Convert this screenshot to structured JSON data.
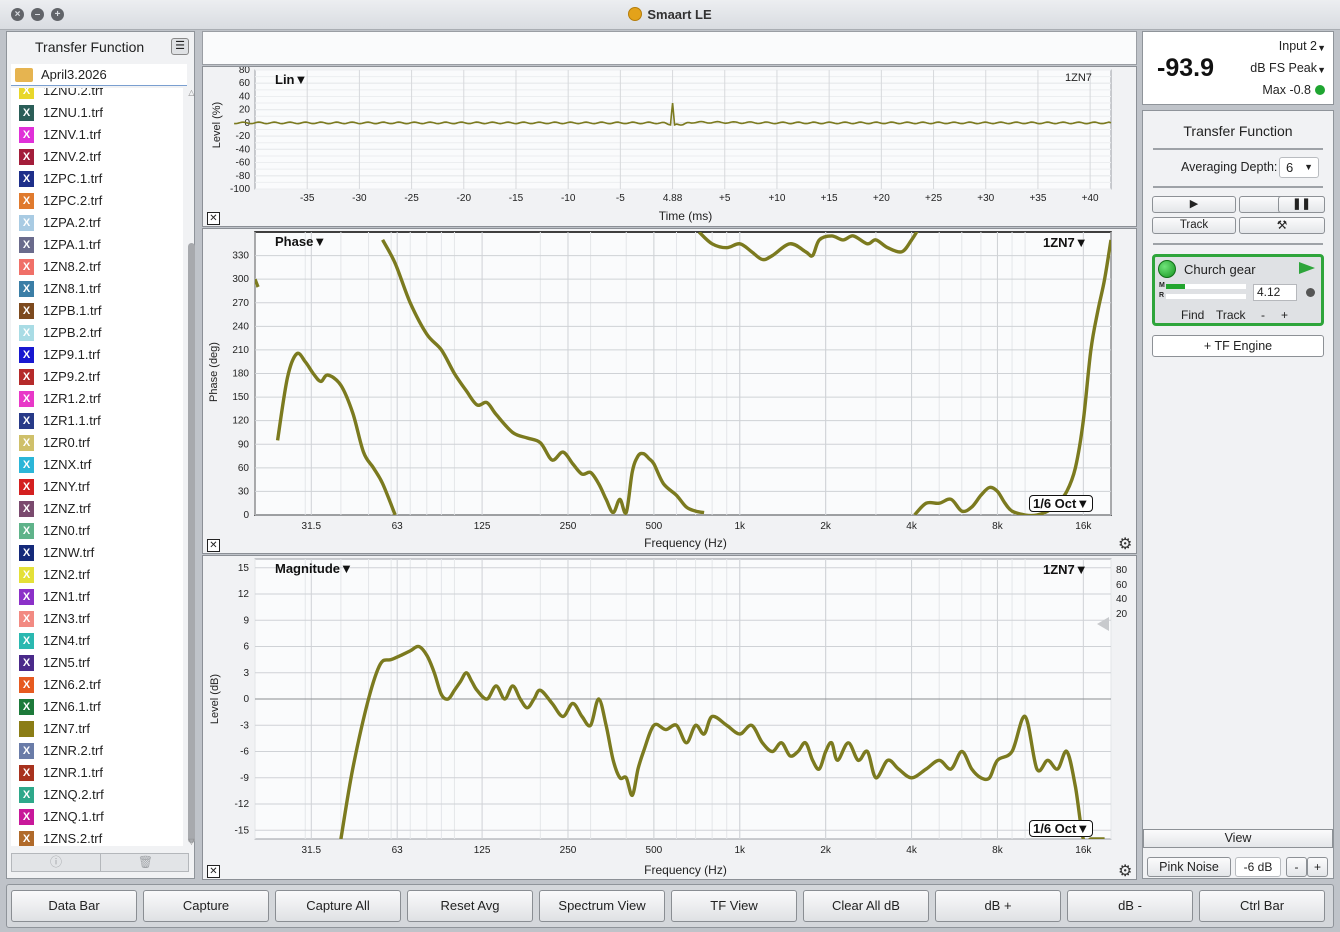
{
  "window": {
    "title": "Smaart LE"
  },
  "left_panel": {
    "title": "Transfer Function",
    "folder": "April3.2026",
    "files": [
      {
        "name": "1ZNU.2.trf",
        "color": "#e8d72a"
      },
      {
        "name": "1ZNU.1.trf",
        "color": "#2b5e58"
      },
      {
        "name": "1ZNV.1.trf",
        "color": "#e030d8"
      },
      {
        "name": "1ZNV.2.trf",
        "color": "#a31d3a"
      },
      {
        "name": "1ZPC.1.trf",
        "color": "#1e2f8a"
      },
      {
        "name": "1ZPC.2.trf",
        "color": "#e07a2e"
      },
      {
        "name": "1ZPA.2.trf",
        "color": "#a9cbe3"
      },
      {
        "name": "1ZPA.1.trf",
        "color": "#6a6b8c"
      },
      {
        "name": "1ZN8.2.trf",
        "color": "#f07068"
      },
      {
        "name": "1ZN8.1.trf",
        "color": "#3b7ea6"
      },
      {
        "name": "1ZPB.1.trf",
        "color": "#7d4a1e"
      },
      {
        "name": "1ZPB.2.trf",
        "color": "#a9dce5"
      },
      {
        "name": "1ZP9.1.trf",
        "color": "#1818d0"
      },
      {
        "name": "1ZP9.2.trf",
        "color": "#b52a2a"
      },
      {
        "name": "1ZR1.2.trf",
        "color": "#e838c8"
      },
      {
        "name": "1ZR1.1.trf",
        "color": "#283a88"
      },
      {
        "name": "1ZR0.trf",
        "color": "#cfc06a"
      },
      {
        "name": "1ZNX.trf",
        "color": "#2bb6d8"
      },
      {
        "name": "1ZNY.trf",
        "color": "#d42020"
      },
      {
        "name": "1ZNZ.trf",
        "color": "#7a4a6e"
      },
      {
        "name": "1ZN0.trf",
        "color": "#5fb38a"
      },
      {
        "name": "1ZNW.trf",
        "color": "#152a7a"
      },
      {
        "name": "1ZN2.trf",
        "color": "#e4e038"
      },
      {
        "name": "1ZN1.trf",
        "color": "#8b30c8"
      },
      {
        "name": "1ZN3.trf",
        "color": "#f28a82"
      },
      {
        "name": "1ZN4.trf",
        "color": "#2ab8b0"
      },
      {
        "name": "1ZN5.trf",
        "color": "#4a2a8a"
      },
      {
        "name": "1ZN6.2.trf",
        "color": "#e65a20"
      },
      {
        "name": "1ZN6.1.trf",
        "color": "#1d7a3a"
      },
      {
        "name": "1ZN7.trf",
        "color": "#8b7d16"
      },
      {
        "name": "1ZNR.2.trf",
        "color": "#6a7ca8"
      },
      {
        "name": "1ZNR.1.trf",
        "color": "#a8321e"
      },
      {
        "name": "1ZNQ.2.trf",
        "color": "#2ea88a"
      },
      {
        "name": "1ZNQ.1.trf",
        "color": "#c8189a"
      },
      {
        "name": "1ZNS.2.trf",
        "color": "#b06a2a"
      }
    ],
    "footer": {
      "info_icon": "info-icon",
      "trash_icon": "trash-icon"
    }
  },
  "plots": {
    "ir": {
      "label": "Lin",
      "trace": "1ZN7",
      "xlabel": "Time (ms)",
      "ylabel": "Level (%)"
    },
    "phase": {
      "label": "Phase",
      "trace": "1ZN7",
      "xlabel": "Frequency (Hz)",
      "ylabel": "Phase (deg)",
      "smoothing": "1/6 Oct"
    },
    "magnitude": {
      "label": "Magnitude",
      "trace": "1ZN7",
      "xlabel": "Frequency (Hz)",
      "ylabel": "Level (dB)",
      "smoothing": "1/6 Oct",
      "coherence_ticks": [
        "80",
        "60",
        "40",
        "20"
      ]
    }
  },
  "chart_data": [
    {
      "type": "line",
      "name": "impulse",
      "ylim": [
        -100,
        80
      ],
      "xlim": [
        -40,
        42
      ],
      "yticks": [
        "80",
        "60",
        "40",
        "20",
        "0",
        "-20",
        "-40",
        "-60",
        "-80",
        "-100"
      ],
      "xticks": [
        "-35",
        "-30",
        "-25",
        "-20",
        "-15",
        "-10",
        "-5",
        "4.88",
        "+5",
        "+10",
        "+15",
        "+20",
        "+25",
        "+30",
        "+35",
        "+40"
      ],
      "series": [
        {
          "x": [
            -42,
            -10,
            -1,
            -0.2,
            0,
            0.2,
            1,
            2,
            10,
            42
          ],
          "values": [
            0,
            0,
            0,
            -2,
            30,
            -3,
            -2,
            1,
            0,
            0
          ]
        }
      ],
      "color": "#7b7a1f"
    },
    {
      "type": "line",
      "name": "phase",
      "ylim": [
        0,
        360
      ],
      "xlim": [
        20,
        20000
      ],
      "xscale": "log",
      "yticks": [
        "330",
        "300",
        "270",
        "240",
        "210",
        "180",
        "150",
        "120",
        "90",
        "60",
        "30",
        "0"
      ],
      "xticks": [
        "31.5",
        "63",
        "125",
        "250",
        "500",
        "1k",
        "2k",
        "4k",
        "8k",
        "16k"
      ],
      "segments": [
        {
          "x": [
            20,
            20.5
          ],
          "values": [
            300,
            290
          ]
        },
        {
          "x": [
            24,
            26,
            28,
            30,
            32,
            34,
            36,
            40,
            44,
            48,
            52,
            56,
            62
          ],
          "values": [
            95,
            175,
            205,
            195,
            180,
            170,
            178,
            165,
            130,
            80,
            60,
            40,
            0
          ]
        },
        {
          "x": [
            56,
            62,
            70,
            80,
            90,
            100,
            110,
            120,
            130,
            140,
            160,
            180,
            200,
            220,
            240,
            260,
            280,
            300,
            320,
            340,
            360,
            380,
            400,
            420,
            440,
            460,
            480,
            500,
            540,
            600,
            650,
            700,
            750
          ],
          "values": [
            350,
            320,
            270,
            230,
            210,
            180,
            158,
            140,
            143,
            128,
            105,
            98,
            92,
            70,
            80,
            65,
            52,
            54,
            40,
            20,
            3,
            20,
            3,
            55,
            75,
            78,
            72,
            65,
            40,
            25,
            10,
            5,
            3
          ]
        },
        {
          "x": [
            720,
            800,
            900,
            1000,
            1100,
            1200,
            1300,
            1500,
            1700,
            1800,
            1900,
            2100,
            2300,
            2500,
            2800,
            3000,
            3300,
            3700,
            4000,
            4200
          ],
          "values": [
            360,
            345,
            340,
            345,
            335,
            325,
            330,
            345,
            335,
            330,
            350,
            355,
            350,
            355,
            345,
            350,
            340,
            335,
            350,
            362
          ]
        },
        {
          "x": [
            4100,
            4500,
            5000,
            5500,
            6000,
            6500,
            7000,
            7500,
            8000,
            8500,
            9000,
            10000,
            11000,
            12000,
            13000,
            14000,
            15000,
            16000,
            17000,
            18000,
            19000,
            20000
          ],
          "values": [
            0,
            15,
            15,
            20,
            5,
            10,
            25,
            35,
            30,
            15,
            5,
            0,
            0,
            5,
            15,
            30,
            60,
            120,
            210,
            260,
            300,
            350
          ]
        }
      ],
      "color": "#7b7a1f"
    },
    {
      "type": "line",
      "name": "magnitude",
      "ylim": [
        -16,
        16
      ],
      "xlim": [
        20,
        20000
      ],
      "xscale": "log",
      "yticks": [
        "15",
        "12",
        "9",
        "6",
        "3",
        "0",
        "-3",
        "-6",
        "-9",
        "-12",
        "-15"
      ],
      "xticks": [
        "31.5",
        "63",
        "125",
        "250",
        "500",
        "1k",
        "2k",
        "4k",
        "8k",
        "16k"
      ],
      "series": [
        {
          "x": [
            40,
            44,
            50,
            55,
            60,
            65,
            70,
            75,
            80,
            85,
            90,
            95,
            100,
            105,
            110,
            115,
            120,
            130,
            140,
            150,
            160,
            170,
            180,
            190,
            200,
            220,
            240,
            260,
            280,
            300,
            320,
            340,
            360,
            380,
            400,
            420,
            440,
            460,
            500,
            550,
            600,
            650,
            700,
            750,
            800,
            900,
            1000,
            1100,
            1200,
            1300,
            1400,
            1500,
            1600,
            1700,
            1800,
            1900,
            2000,
            2100,
            2200,
            2400,
            2600,
            2800,
            3000,
            3300,
            3600,
            4000,
            4500,
            5000,
            5500,
            6000,
            6500,
            7000,
            7500,
            8000,
            9000,
            10000,
            11000,
            12000,
            13000,
            14000,
            15000,
            16000,
            17000,
            18000,
            19000
          ],
          "values": [
            -16,
            -8,
            0,
            4,
            4.5,
            5,
            5.5,
            6,
            5,
            3,
            0.5,
            0,
            1,
            2,
            3,
            2,
            1,
            0,
            1.5,
            0,
            1.5,
            0,
            -1,
            0,
            1,
            -0.5,
            -2,
            -0.5,
            -2,
            -3,
            0,
            -3,
            -7,
            -9,
            -9,
            -11,
            -8,
            -6,
            -3,
            -3.5,
            -3,
            -5,
            -3,
            -4,
            -2,
            -3,
            -4,
            -3,
            -5,
            -6,
            -5,
            -6.5,
            -6,
            -5,
            -7,
            -8,
            -6,
            -5,
            -7,
            -5,
            -7,
            -6,
            -9,
            -7,
            -8,
            -9,
            -8,
            -7,
            -8,
            -6,
            -8,
            -9,
            -9,
            -7,
            -6,
            -2,
            -8,
            -7,
            -8,
            -6,
            -10,
            -16,
            -16,
            -16,
            -16
          ],
          "clip_end": true
        }
      ],
      "color": "#7b7a1f"
    }
  ],
  "right_panel": {
    "level": "-93.9",
    "input": "Input 2",
    "mode": "dB FS Peak",
    "max": "Max -0.8",
    "section": "Transfer Function",
    "averaging_label": "Averaging Depth:",
    "averaging_value": "6",
    "track_label": "Track",
    "measurement": {
      "name": "Church gear",
      "value": "4.12",
      "find": "Find",
      "track": "Track",
      "minus": "-",
      "plus": "+",
      "m": "M",
      "r": "R"
    },
    "add_engine": "+ TF Engine",
    "view_label": "View",
    "pink_noise": "Pink Noise",
    "noise_level": "-6 dB",
    "minus": "-",
    "plus": "+"
  },
  "bottom_bar": [
    "Data Bar",
    "Capture",
    "Capture All",
    "Reset Avg",
    "Spectrum View",
    "TF View",
    "Clear All dB",
    "dB +",
    "dB -",
    "Ctrl Bar"
  ]
}
